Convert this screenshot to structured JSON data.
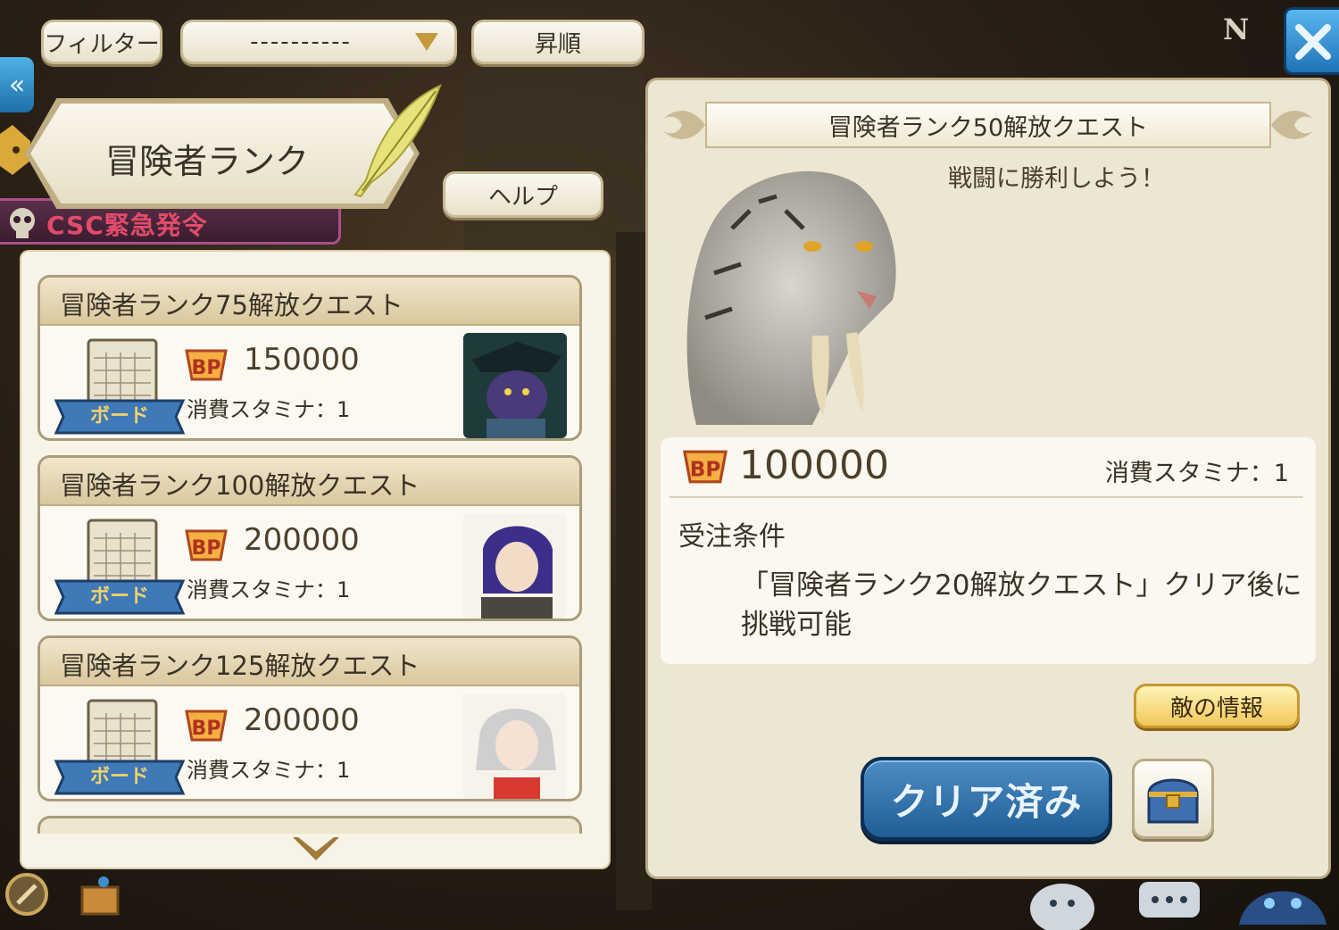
{
  "toolbar": {
    "filter_label": "フィルター",
    "sort_value": "----------",
    "order_label": "昇順"
  },
  "banner": {
    "title": "冒険者ランク"
  },
  "help_label": "ヘルプ",
  "side": {
    "csc_label": "CSC緊急発令"
  },
  "badge": {
    "n_label": "N"
  },
  "quests": [
    {
      "title": "冒険者ランク75解放クエスト",
      "board_label": "ボード",
      "bp": "150000",
      "stamina": "消費スタミナ：1"
    },
    {
      "title": "冒険者ランク100解放クエスト",
      "board_label": "ボード",
      "bp": "200000",
      "stamina": "消費スタミナ：1"
    },
    {
      "title": "冒険者ランク125解放クエスト",
      "board_label": "ボード",
      "bp": "200000",
      "stamina": "消費スタミナ：1"
    }
  ],
  "detail": {
    "title": "冒険者ランク50解放クエスト",
    "description": "戦闘に勝利しよう！",
    "bp": "100000",
    "stamina": "消費スタミナ：1",
    "condition_title": "受注条件",
    "condition_text": "「冒険者ランク20解放クエスト」クリア後に挑戦可能",
    "enemy_info_label": "敵の情報",
    "clear_label": "クリア済み"
  },
  "colors": {
    "panel": "#f7f3e6",
    "accent_blue": "#1f5d96",
    "gold": "#f1c95a"
  }
}
